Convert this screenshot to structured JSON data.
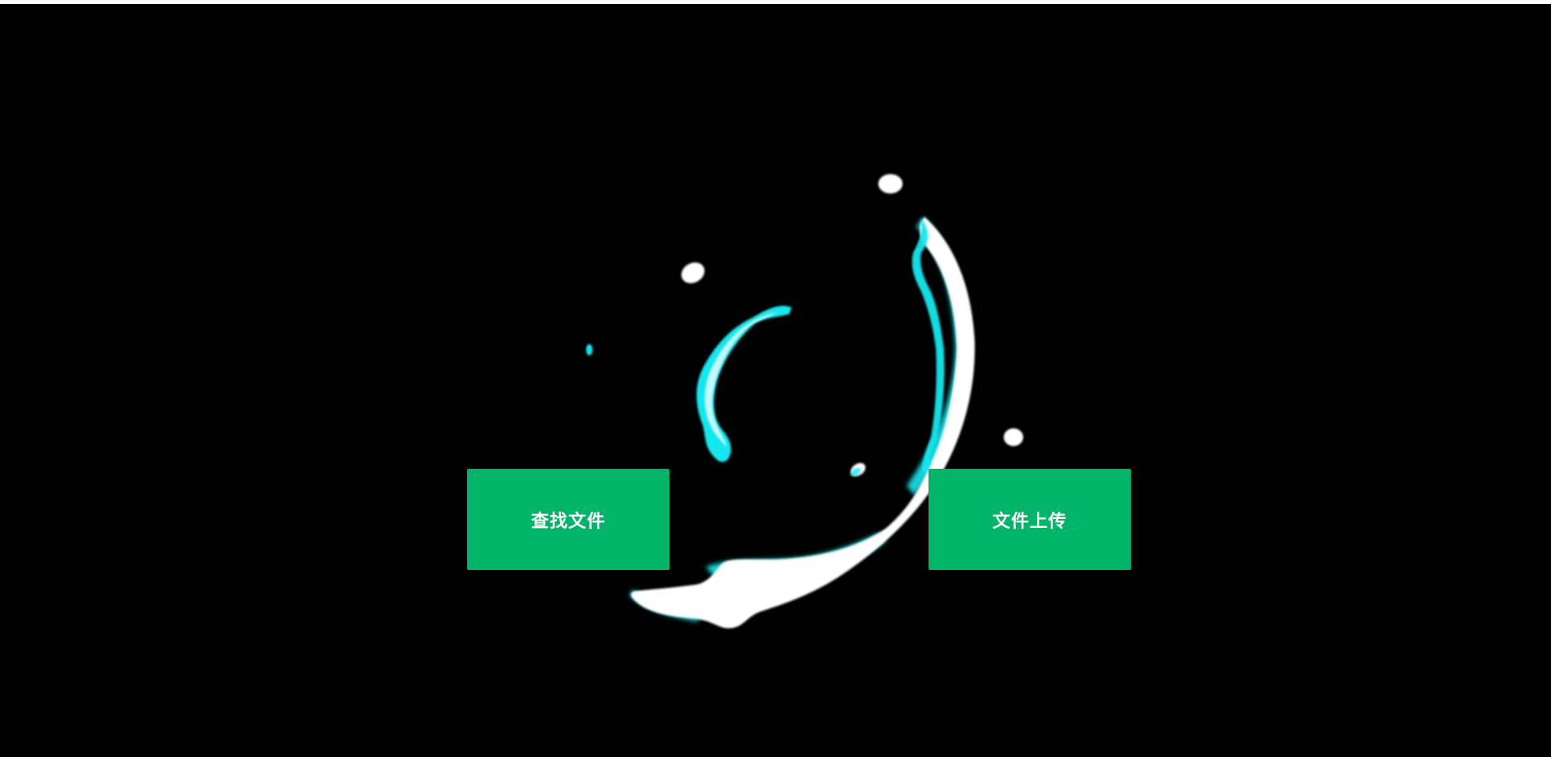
{
  "colors": {
    "background": "#000000",
    "button": "#02b36a",
    "button_text": "#ffffff",
    "fluid_primary": "#ffffff",
    "fluid_accent": "#19e6ee"
  },
  "buttons": {
    "search_files": "查找文件",
    "upload_file": "文件上传"
  }
}
